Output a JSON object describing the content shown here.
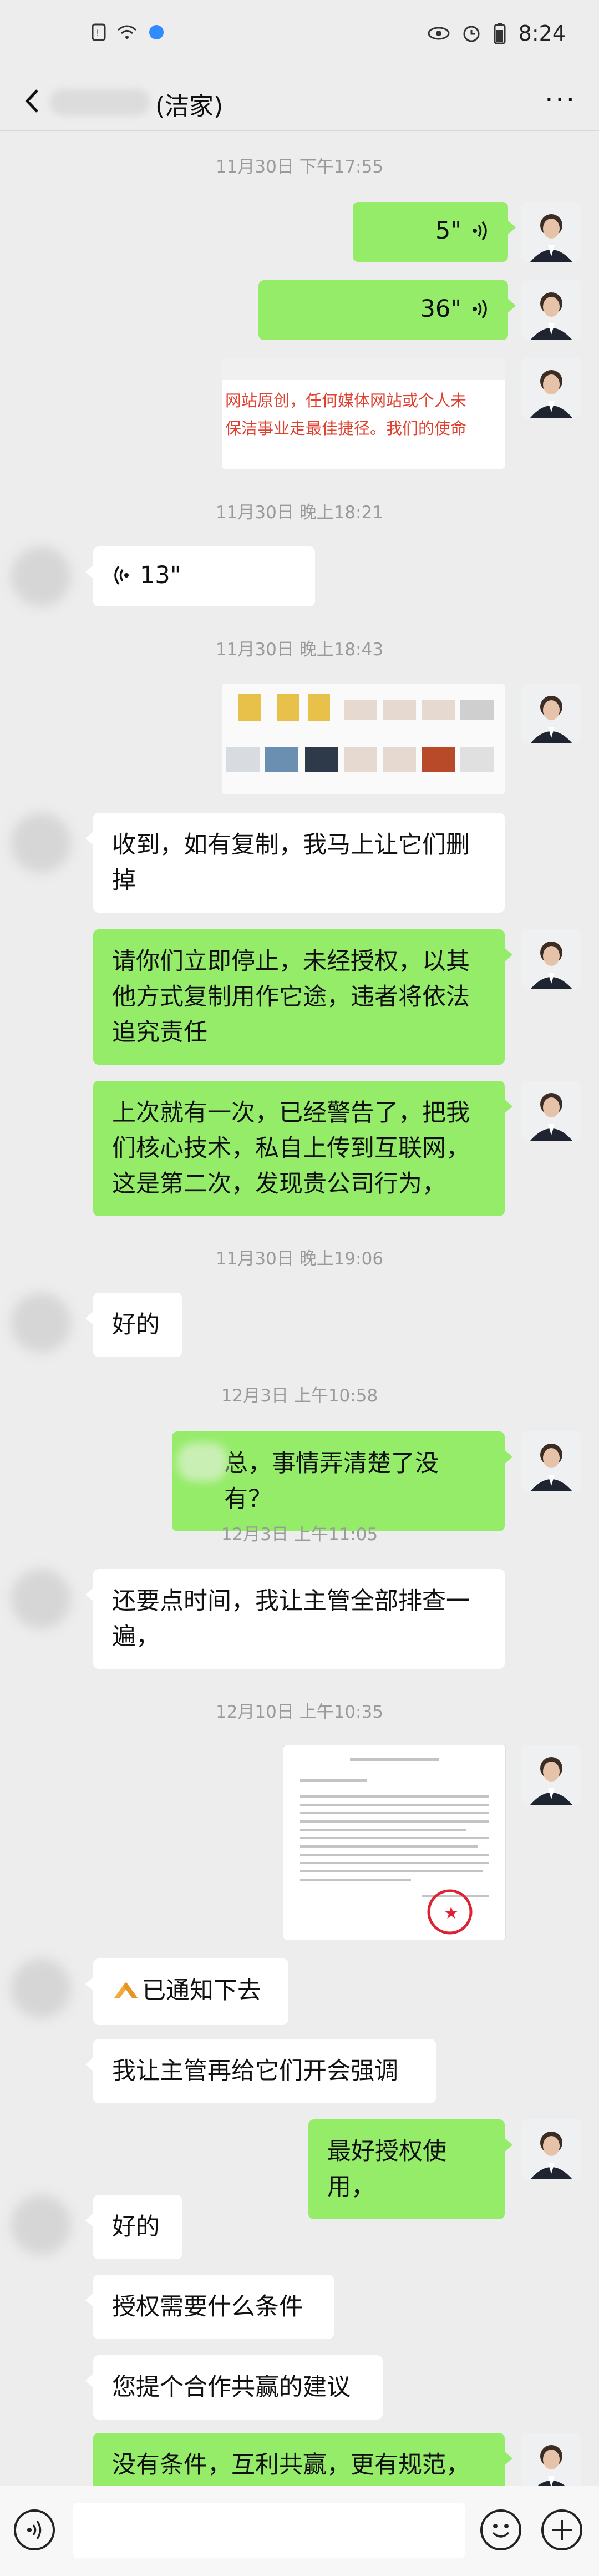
{
  "status_bar": {
    "time": "8:24"
  },
  "header": {
    "title": "(洁家)",
    "more": "···"
  },
  "messages": {
    "t1": "11月30日 下午17:55",
    "v1": "5\"",
    "v2": "36\"",
    "img1_line1": "网站原创，任何媒体网站或个人未",
    "img1_line2": "保洁事业走最佳捷径。我们的使命",
    "t2": "11月30日 晚上18:21",
    "v3": "13\"",
    "t3": "11月30日 晚上18:43",
    "m1": "收到，如有复制，我马上让它们删掉",
    "m2": "请你们立即停止，未经授权，以其他方式复制用作它途，违者将依法追究责任",
    "m3": "上次就有一次，已经警告了，把我们核心技术，私自上传到互联网，这是第二次，发现贵公司行为，",
    "t4": "11月30日 晚上19:06",
    "m4": "好的",
    "t5": "12月3日 上午10:58",
    "m5": "总，事情弄清楚了没有？",
    "t6": "12月3日 上午11:05",
    "m6": "还要点时间，我让主管全部排查一遍，",
    "t7": "12月10日 上午10:35",
    "m7": "已通知下去",
    "m8": "我让主管再给它们开会强调",
    "m9": "最好授权使用，",
    "m10": "好的",
    "m11": "授权需要什么条件",
    "m12": "您提个合作共赢的建议",
    "m13": "没有条件，互利共赢，更有规范，"
  },
  "colors": {
    "me": "#95ec69",
    "other": "#ffffff",
    "bg": "#ededed"
  }
}
